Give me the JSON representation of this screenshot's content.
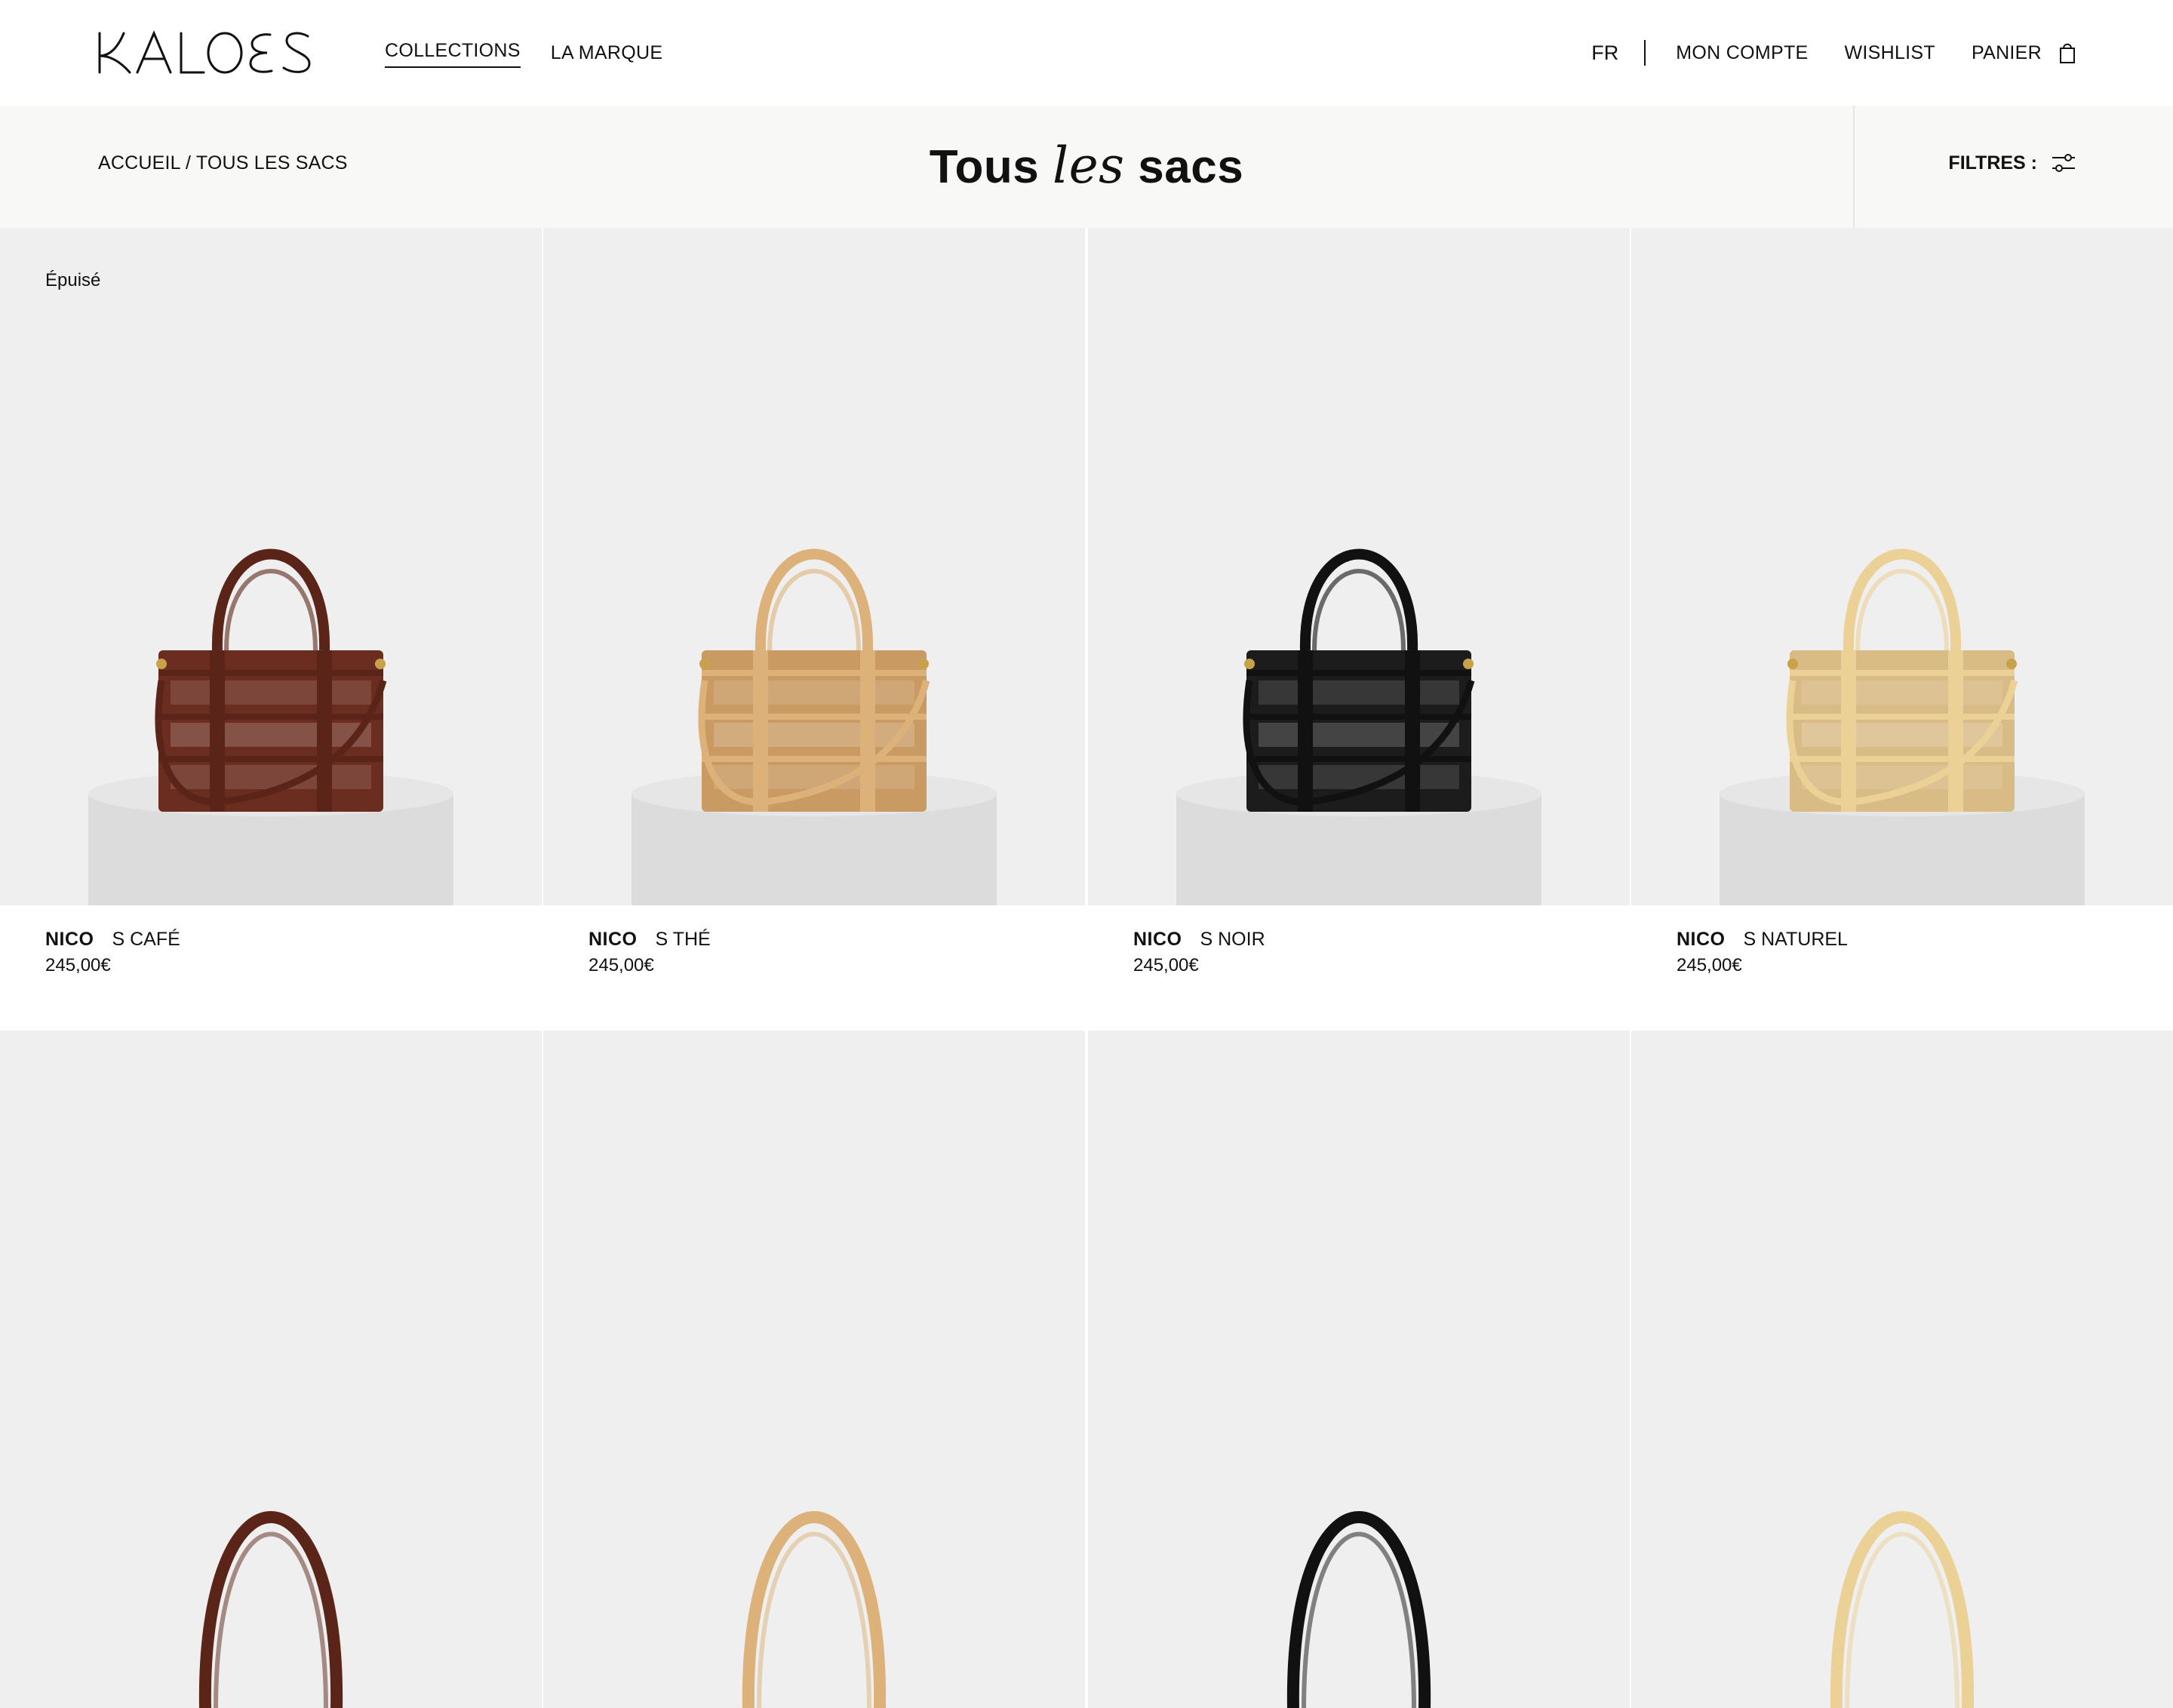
{
  "brand": {
    "logo_text": "KALOES"
  },
  "nav": {
    "collections": "COLLECTIONS",
    "la_marque": "LA MARQUE",
    "lang": "FR",
    "mon_compte": "MON COMPTE",
    "wishlist": "WISHLIST",
    "panier": "PANIER"
  },
  "icons": {
    "cart": "shopping-bag-icon",
    "filters": "sliders-icon"
  },
  "breadcrumb": {
    "home": "ACCUEIL",
    "sep": " / ",
    "current": "TOUS LES SACS"
  },
  "title": {
    "part1": "Tous ",
    "italic": "les",
    "part2": " sacs"
  },
  "filters": {
    "label": "FILTRES :"
  },
  "products": [
    {
      "badge": "Épuisé",
      "name": "NICO",
      "variant": "S CAFÉ",
      "price": "245,00€",
      "color": "#6b2d1f",
      "strap": "#5b2418"
    },
    {
      "badge": "",
      "name": "NICO",
      "variant": "S THÉ",
      "price": "245,00€",
      "color": "#c99a62",
      "strap": "#ddb27a"
    },
    {
      "badge": "",
      "name": "NICO",
      "variant": "S NOIR",
      "price": "245,00€",
      "color": "#1c1c1c",
      "strap": "#111111"
    },
    {
      "badge": "",
      "name": "NICO",
      "variant": "S NATUREL",
      "price": "245,00€",
      "color": "#d9bb86",
      "strap": "#ecd196"
    }
  ],
  "products_row2": [
    {
      "color": "#6b2d1f",
      "strap": "#5b2418"
    },
    {
      "color": "#c99a62",
      "strap": "#ddb27a"
    },
    {
      "color": "#1c1c1c",
      "strap": "#111111"
    },
    {
      "color": "#d9bb86",
      "strap": "#ecd196"
    }
  ],
  "colors": {
    "accent": "#111111",
    "titlebar_bg": "#f8f8f6",
    "image_bg": "#efefef"
  }
}
